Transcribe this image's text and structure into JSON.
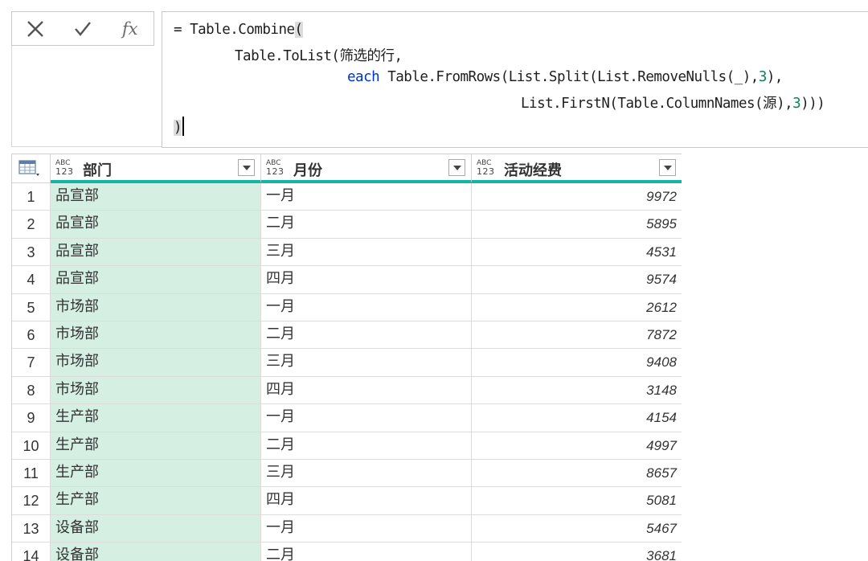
{
  "formula_bar": {
    "cancel_icon": "close-icon",
    "confirm_icon": "check-icon",
    "fx_label": "fx",
    "line1_pre": "= Table.Combine",
    "line1_paren": "(",
    "line2": "Table.ToList(筛选的行,",
    "line3_kw": "each",
    "line3_a": " Table.FromRows(List.Split(List.RemoveNulls(_),",
    "line3_num": "3",
    "line3_b": "),",
    "line4_a": "List.FirstN(Table.ColumnNames(源),",
    "line4_num": "3",
    "line4_b": ")))",
    "line5": ")"
  },
  "table": {
    "type_icon_top": "ABC",
    "type_icon_bottom": "123",
    "columns": [
      "部门",
      "月份",
      "活动经费"
    ],
    "rows": [
      {
        "n": "1",
        "dept": "品宣部",
        "month": "一月",
        "amount": "9972"
      },
      {
        "n": "2",
        "dept": "品宣部",
        "month": "二月",
        "amount": "5895"
      },
      {
        "n": "3",
        "dept": "品宣部",
        "month": "三月",
        "amount": "4531"
      },
      {
        "n": "4",
        "dept": "品宣部",
        "month": "四月",
        "amount": "9574"
      },
      {
        "n": "5",
        "dept": "市场部",
        "month": "一月",
        "amount": "2612"
      },
      {
        "n": "6",
        "dept": "市场部",
        "month": "二月",
        "amount": "7872"
      },
      {
        "n": "7",
        "dept": "市场部",
        "month": "三月",
        "amount": "9408"
      },
      {
        "n": "8",
        "dept": "市场部",
        "month": "四月",
        "amount": "3148"
      },
      {
        "n": "9",
        "dept": "生产部",
        "month": "一月",
        "amount": "4154"
      },
      {
        "n": "10",
        "dept": "生产部",
        "month": "二月",
        "amount": "4997"
      },
      {
        "n": "11",
        "dept": "生产部",
        "month": "三月",
        "amount": "8657"
      },
      {
        "n": "12",
        "dept": "生产部",
        "month": "四月",
        "amount": "5081"
      },
      {
        "n": "13",
        "dept": "设备部",
        "month": "一月",
        "amount": "5467"
      },
      {
        "n": "14",
        "dept": "设备部",
        "month": "二月",
        "amount": "3681"
      }
    ]
  },
  "colors": {
    "header_underline": "#14b4a6",
    "selected_column": "#d5efe3",
    "keyword": "#0033cc",
    "number": "#098658"
  }
}
